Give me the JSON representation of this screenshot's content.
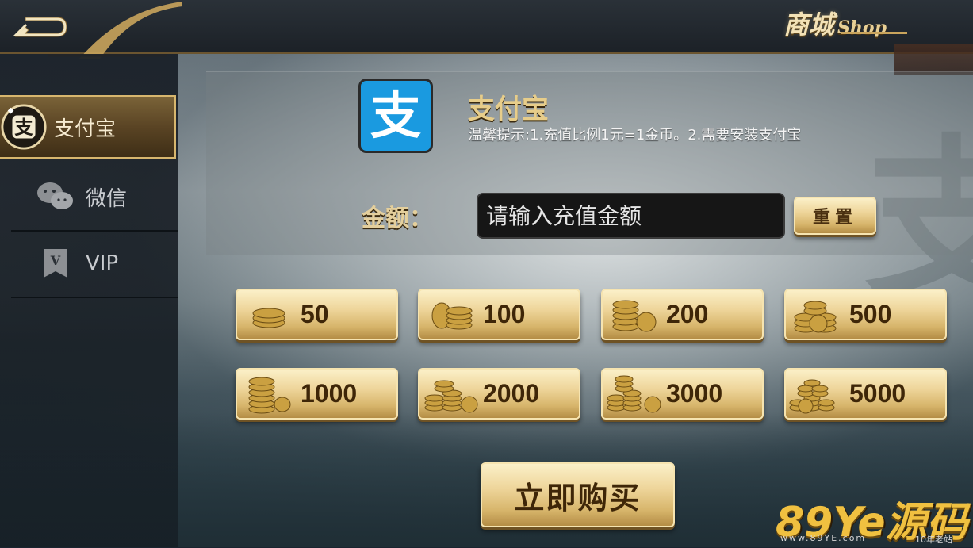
{
  "header": {
    "back_icon": "back-arrow-icon",
    "shop_title_cn": "商城",
    "shop_title_en": "Shop"
  },
  "sidebar": {
    "items": [
      {
        "label": "支付宝",
        "icon": "alipay-icon",
        "active": true
      },
      {
        "label": "微信",
        "icon": "wechat-icon",
        "active": false
      },
      {
        "label": "VIP",
        "icon": "vip-icon",
        "active": false
      }
    ]
  },
  "payment": {
    "method_title": "支付宝",
    "tip": "温馨提示:1.充值比例1元=1金币。2.需要安装支付宝",
    "amount_label": "金额：",
    "amount_placeholder": "请输入充值金额",
    "amount_value": "",
    "reset_label": "重置",
    "logo_glyph": "支"
  },
  "packages": [
    {
      "value": "50",
      "icon": "coin-stack-icon"
    },
    {
      "value": "100",
      "icon": "coin-stack-icon"
    },
    {
      "value": "200",
      "icon": "coin-stack-icon"
    },
    {
      "value": "500",
      "icon": "coin-stack-icon"
    },
    {
      "value": "1000",
      "icon": "coin-pile-icon"
    },
    {
      "value": "2000",
      "icon": "coin-pile-icon"
    },
    {
      "value": "3000",
      "icon": "coin-pile-icon"
    },
    {
      "value": "5000",
      "icon": "coin-pile-icon"
    }
  ],
  "buy_label": "立即购买",
  "watermark": {
    "brand": "89Ye源码",
    "url": "www.89YE.com",
    "tag": "10年老站"
  },
  "colors": {
    "gold": "#e7cd8a",
    "alipay_blue": "#1a9ae0",
    "sidebar_bg": "#1b2129"
  }
}
